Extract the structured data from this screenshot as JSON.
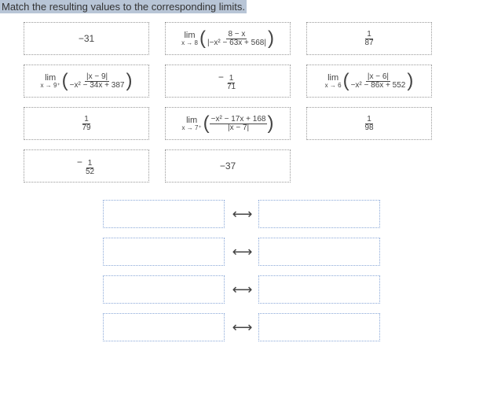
{
  "instruction": "Match the resulting values to the corresponding limits.",
  "tiles": {
    "r1c1": "−31",
    "r1c2_limtop": "lim",
    "r1c2_limbot": "x → 8",
    "r1c2_num": "8 − x",
    "r1c2_den": "|−x² − 63x + 568|",
    "r1c3_num": "1",
    "r1c3_den": "87",
    "r2c1_limtop": "lim",
    "r2c1_limbot": "x → 9⁺",
    "r2c1_num": "|x − 9|",
    "r2c1_den": "−x² − 34x + 387",
    "r2c2_num": "1",
    "r2c2_den": "71",
    "r2c3_limtop": "lim",
    "r2c3_limbot": "x → 6",
    "r2c3_num": "|x − 6|",
    "r2c3_den": "−x² − 86x + 552",
    "r3c1_num": "1",
    "r3c1_den": "79",
    "r3c2_limtop": "lim",
    "r3c2_limbot": "x → 7⁺",
    "r3c2_num": "−x² − 17x + 168",
    "r3c2_den": "|x − 7|",
    "r3c3_num": "1",
    "r3c3_den": "98",
    "r4c1_num": "1",
    "r4c1_den": "52",
    "r4c2": "−37"
  },
  "arrow": "⟷"
}
